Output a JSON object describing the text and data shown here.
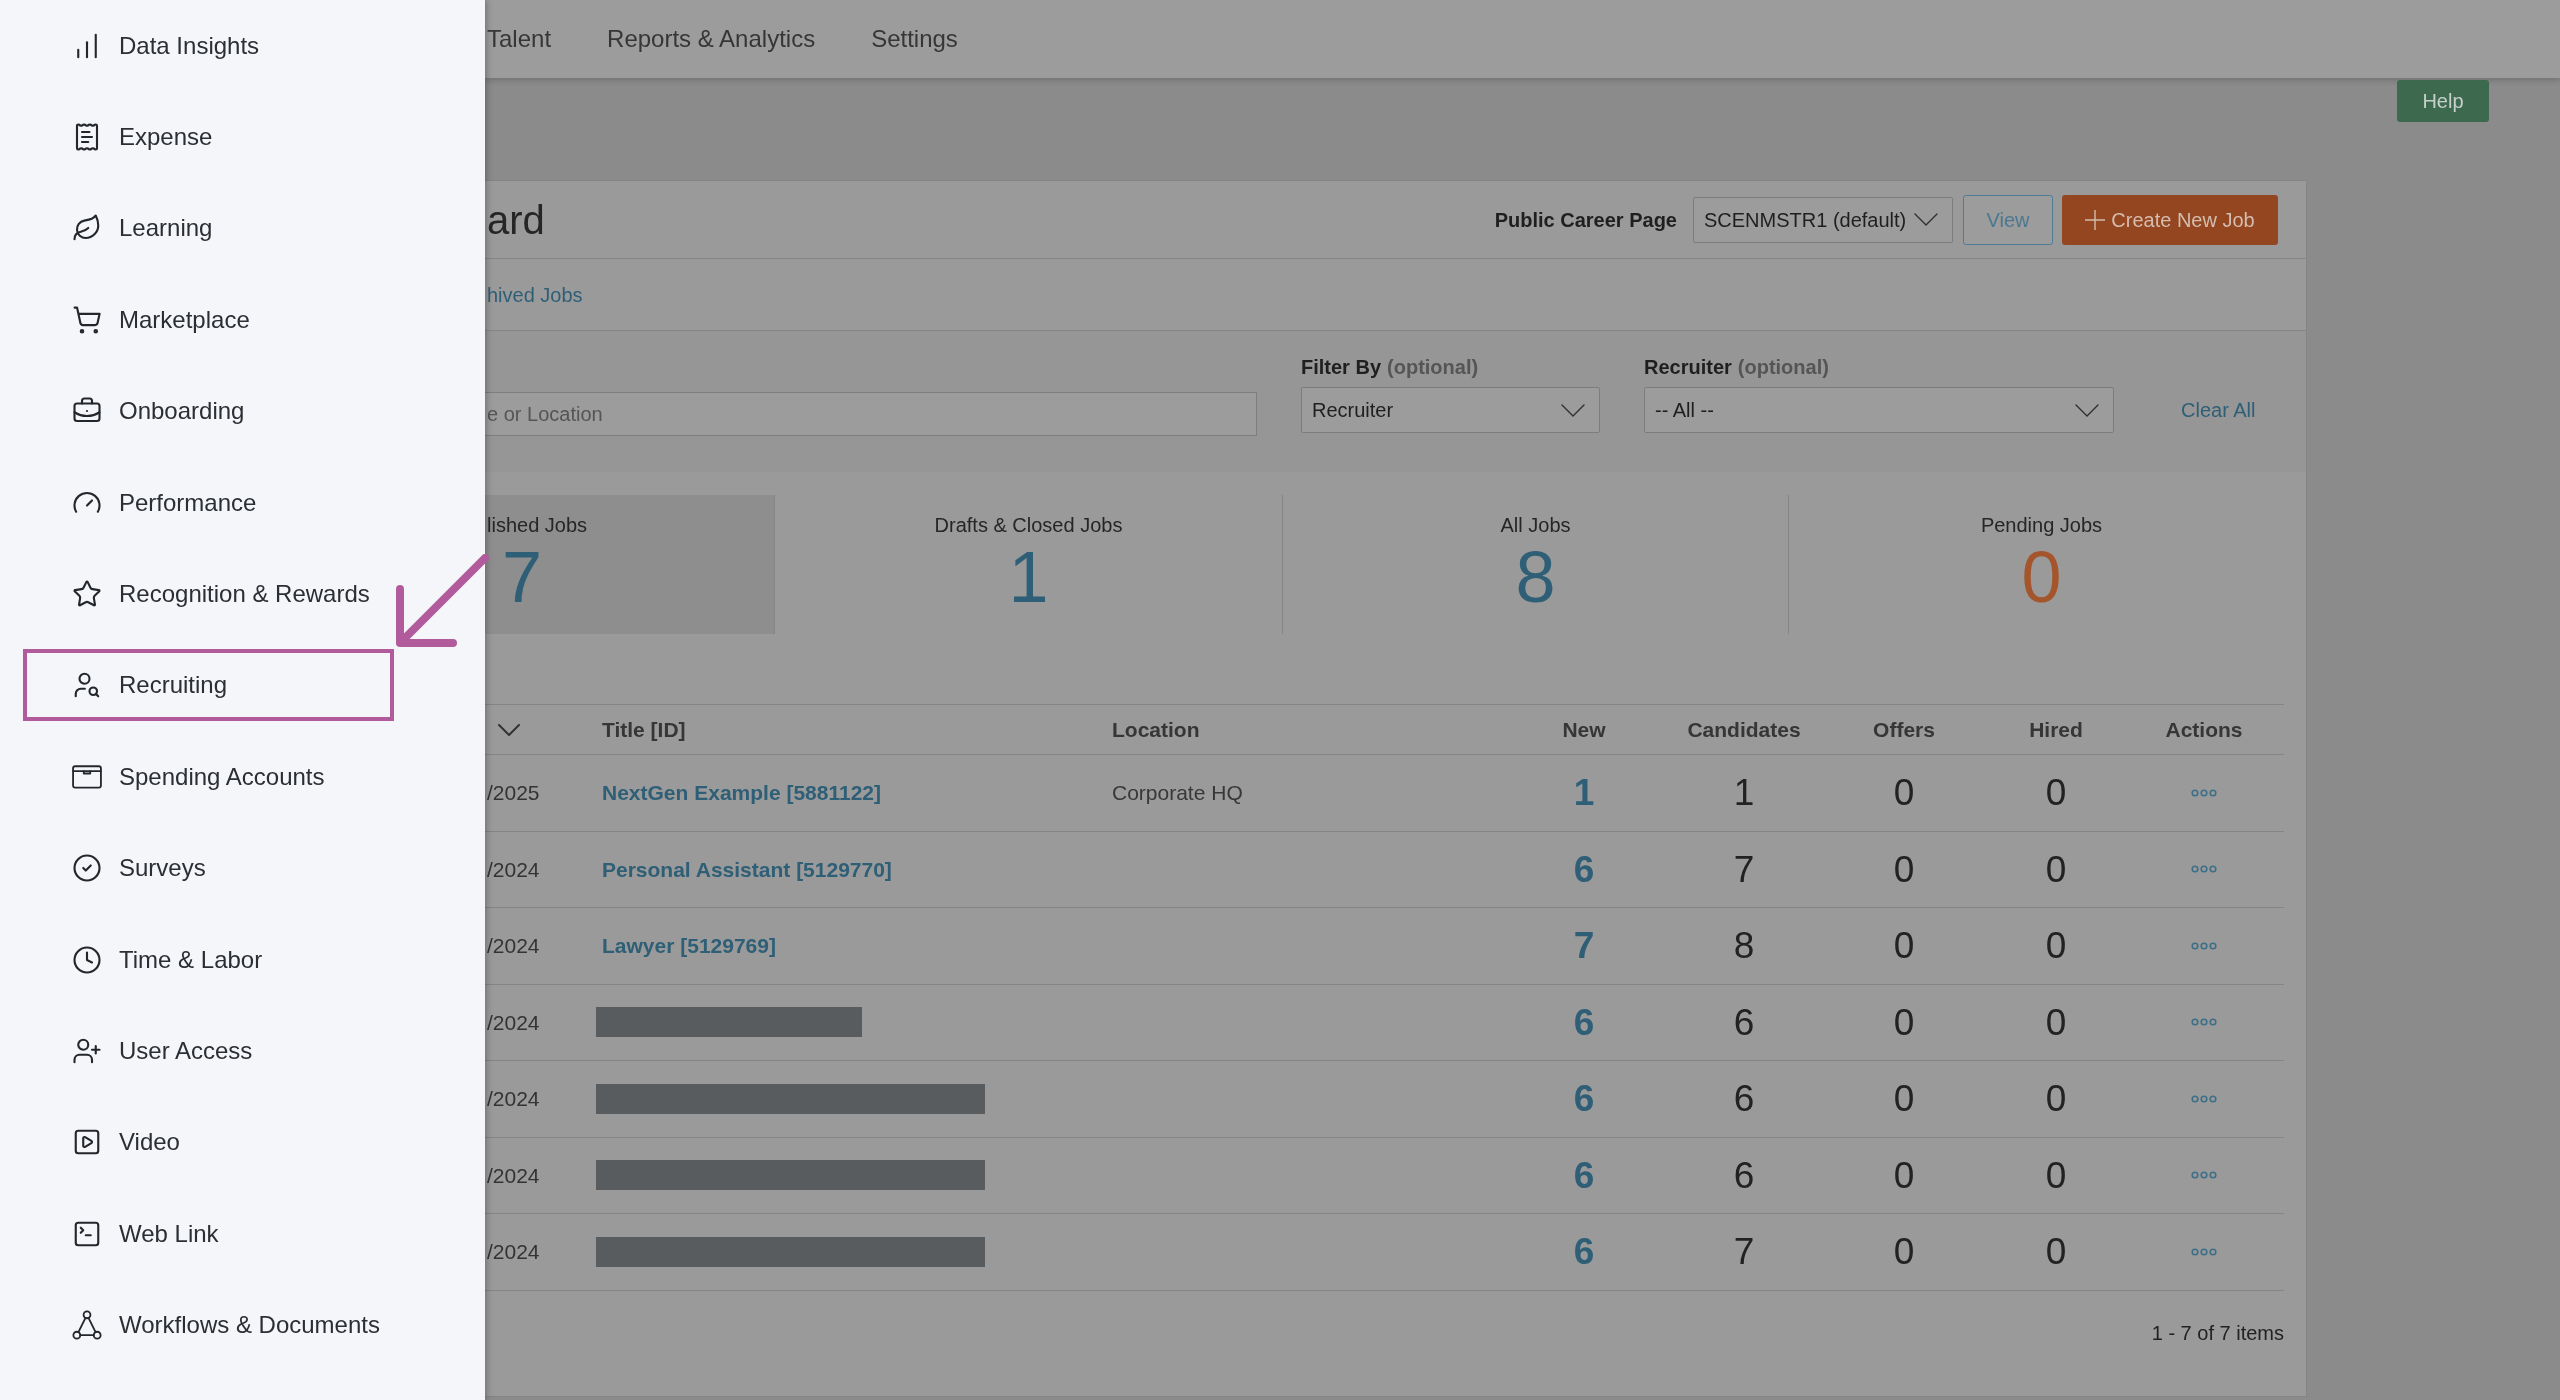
{
  "sidebar": {
    "items": [
      {
        "label": "Data Insights",
        "highlighted": false
      },
      {
        "label": "Expense",
        "highlighted": false
      },
      {
        "label": "Learning",
        "highlighted": false
      },
      {
        "label": "Marketplace",
        "highlighted": false
      },
      {
        "label": "Onboarding",
        "highlighted": false
      },
      {
        "label": "Performance",
        "highlighted": false
      },
      {
        "label": "Recognition & Rewards",
        "highlighted": false
      },
      {
        "label": "Recruiting",
        "highlighted": true
      },
      {
        "label": "Spending Accounts",
        "highlighted": false
      },
      {
        "label": "Surveys",
        "highlighted": false
      },
      {
        "label": "Time & Labor",
        "highlighted": false
      },
      {
        "label": "User Access",
        "highlighted": false
      },
      {
        "label": "Video",
        "highlighted": false
      },
      {
        "label": "Web Link",
        "highlighted": false
      },
      {
        "label": "Workflows & Documents",
        "highlighted": false
      }
    ]
  },
  "top_nav": {
    "items": [
      "Talent",
      "Reports & Analytics",
      "Settings"
    ]
  },
  "help_button": "Help",
  "dashboard": {
    "title": "ard",
    "career_page": {
      "label": "Public Career Page",
      "value": "SCENMSTR1 (default)"
    },
    "buttons": [
      {
        "label": "View",
        "kind": "outline"
      },
      {
        "label": "Create New Job",
        "kind": "primary"
      }
    ],
    "tab_link": "hived Jobs",
    "search": {
      "placeholder": "e or Location"
    },
    "filters": [
      {
        "label": "Filter By",
        "hint": "(optional)",
        "value": "Recruiter"
      },
      {
        "label": "Recruiter",
        "hint": "(optional)",
        "value": "-- All --"
      }
    ],
    "clear_all": "Clear All",
    "stats": [
      {
        "label": "lished Jobs",
        "value": "7",
        "selected": true,
        "color": "#2e5f77"
      },
      {
        "label": "Drafts & Closed Jobs",
        "value": "1",
        "selected": false,
        "color": "#2e5f77"
      },
      {
        "label": "All Jobs",
        "value": "8",
        "selected": false,
        "color": "#2e5f77"
      },
      {
        "label": "Pending Jobs",
        "value": "0",
        "selected": false,
        "color": "#a4552b"
      }
    ],
    "table": {
      "columns": [
        "Title [ID]",
        "Location",
        "New",
        "Candidates",
        "Offers",
        "Hired",
        "Actions"
      ],
      "rows": [
        {
          "date": "/2025",
          "kind": "link",
          "title": "NextGen Example [5881122]",
          "location": "Corporate HQ",
          "new": "1",
          "candidates": "1",
          "offers": "0",
          "hired": "0"
        },
        {
          "date": "/2024",
          "kind": "link",
          "title": "Personal Assistant [5129770]",
          "new": "6",
          "candidates": "7",
          "offers": "0",
          "hired": "0"
        },
        {
          "date": "/2024",
          "kind": "link",
          "title": "Lawyer [5129769]",
          "new": "7",
          "candidates": "8",
          "offers": "0",
          "hired": "0"
        },
        {
          "date": "/2024",
          "kind": "redacted",
          "wide": false,
          "new": "6",
          "candidates": "6",
          "offers": "0",
          "hired": "0"
        },
        {
          "date": "/2024",
          "kind": "redacted",
          "wide": true,
          "new": "6",
          "candidates": "6",
          "offers": "0",
          "hired": "0"
        },
        {
          "date": "/2024",
          "kind": "redacted",
          "wide": true,
          "new": "6",
          "candidates": "6",
          "offers": "0",
          "hired": "0"
        },
        {
          "date": "/2024",
          "kind": "redacted",
          "wide": true,
          "new": "6",
          "candidates": "7",
          "offers": "0",
          "hired": "0"
        }
      ]
    },
    "pagination": "1 - 7 of 7 items"
  }
}
